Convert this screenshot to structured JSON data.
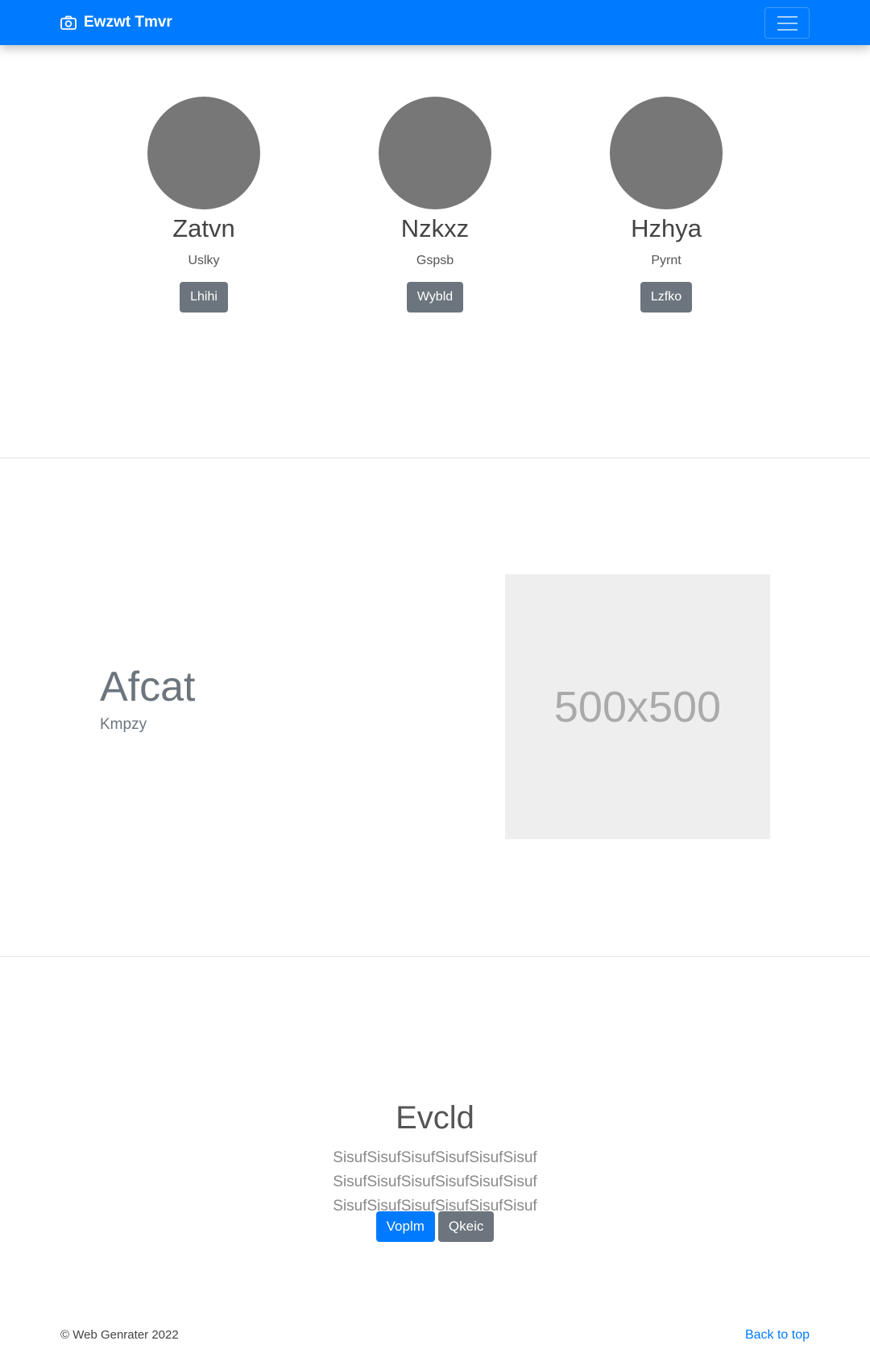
{
  "navbar": {
    "brand": "Ewzwt Tmvr",
    "brand_icon": "camera-icon",
    "toggler_icon": "hamburger-menu-icon"
  },
  "profiles": [
    {
      "name": "Zatvn",
      "role": "Uslky",
      "button": "Lhihi"
    },
    {
      "name": "Nzkxz",
      "role": "Gspsb",
      "button": "Wybld"
    },
    {
      "name": "Hzhya",
      "role": "Pyrnt",
      "button": "Lzfko"
    }
  ],
  "feature": {
    "title": "Afcat",
    "subtitle": "Kmpzy",
    "image_label": "500x500"
  },
  "cta": {
    "title": "Evcld",
    "text": "SisufSisufSisufSisufSisufSisuf SisufSisufSisufSisufSisufSisuf SisufSisufSisufSisufSisufSisuf",
    "primary_button": "Voplm",
    "secondary_button": "Qkeic"
  },
  "footer": {
    "copyright": "© Web Genrater 2022",
    "back_to_top": "Back to top"
  },
  "colors": {
    "primary": "#007bff",
    "secondary": "#6c757d",
    "avatar": "#777777",
    "placeholder": "#eeeeee"
  }
}
